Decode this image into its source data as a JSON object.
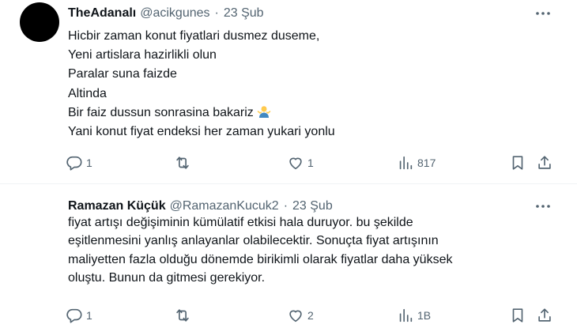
{
  "tweets": [
    {
      "name": "TheAdanalı",
      "handle": "@acikgunes",
      "separator": "·",
      "time": "23 Şub",
      "lines": [
        "Hicbir zaman konut fiyatlari dusmez duseme,",
        "Yeni artislara hazirlikli olun",
        "Paralar suna faizde",
        "Altinda",
        "Bir faiz dussun sonrasina bakariz",
        "Yani konut fiyat endeksi her zaman yukari yonlu"
      ],
      "emoji": "person-shrugging-icon",
      "replies": "1",
      "retweets": "",
      "likes": "1",
      "views": "817"
    },
    {
      "name": "Ramazan Küçük",
      "handle": "@RamazanKucuk2",
      "separator": "·",
      "time": "23 Şub",
      "lines": [
        "fiyat artışı değişiminin kümülatif etkisi hala duruyor. bu şekilde",
        "eşitlenmesini yanlış anlayanlar olabilecektir. Sonuçta fiyat artışının",
        "maliyetten fazla olduğu dönemde birikimli olarak fiyatlar daha yüksek",
        "oluştu. Bunun da gitmesi gerekiyor."
      ],
      "replies": "1",
      "retweets": "",
      "likes": "2",
      "views": "1B"
    }
  ],
  "colors": {
    "text": "#0f1419",
    "secondary": "#536471",
    "divider": "#eff3f4"
  }
}
